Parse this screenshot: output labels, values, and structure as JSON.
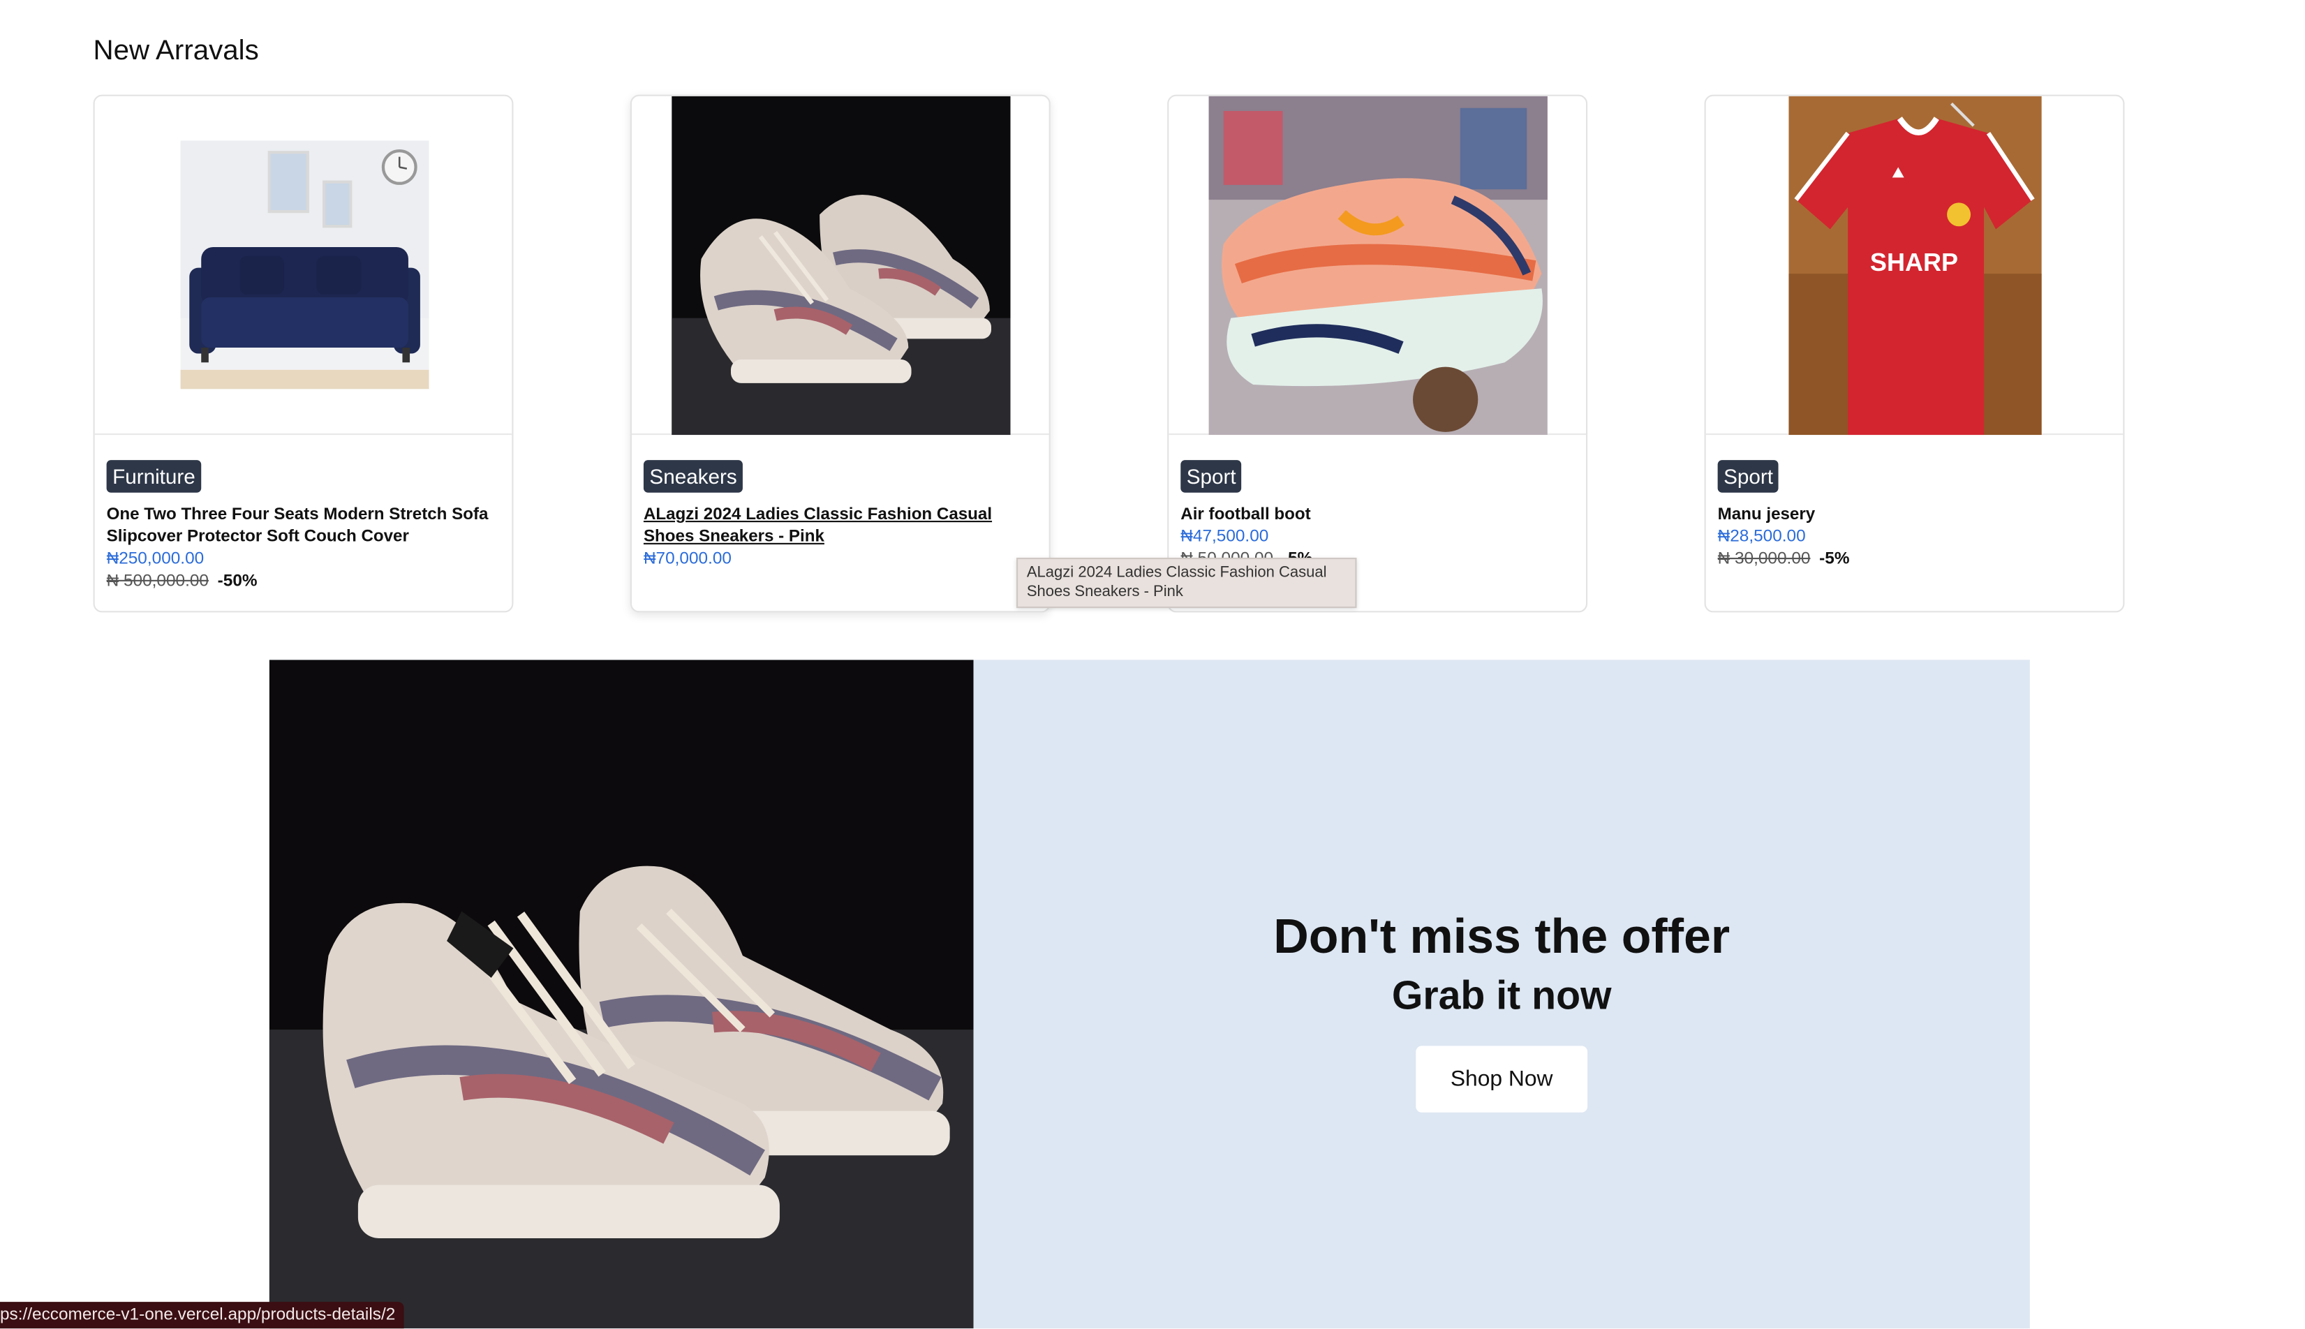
{
  "section": {
    "title": "New Arravals"
  },
  "products": [
    {
      "category": "Furniture",
      "name": "One Two Three Four Seats Modern Stretch Sofa Slipcover Protector Soft Couch Cover",
      "price": "₦250,000.00",
      "old_price": "₦ 500,000.00",
      "discount": "-50%"
    },
    {
      "category": "Sneakers",
      "name": "ALagzi 2024 Ladies Classic Fashion Casual Shoes Sneakers - Pink",
      "price": "₦70,000.00"
    },
    {
      "category": "Sport",
      "name": "Air football boot",
      "price": "₦47,500.00",
      "old_price": "₦ 50,000.00",
      "discount": "-5%"
    },
    {
      "category": "Sport",
      "name": "Manu jesery",
      "price": "₦28,500.00",
      "old_price": "₦ 30,000.00",
      "discount": "-5%"
    }
  ],
  "tooltip": {
    "text": "ALagzi 2024 Ladies Classic Fashion Casual Shoes Sneakers - Pink"
  },
  "banner": {
    "headline": "Don't miss the offer",
    "subline": "Grab it now",
    "button_label": "Shop Now"
  },
  "status_bar": {
    "url": "ps://eccomerce-v1-one.vercel.app/products-details/2"
  },
  "colors": {
    "badge_bg": "#2d3748",
    "price_blue": "#2b6cd9",
    "banner_bg": "#dde7f3",
    "jersey_red": "#d3252f"
  },
  "icons": [
    "sofa-image",
    "sneakers-image",
    "football-boot-image",
    "jersey-image"
  ]
}
